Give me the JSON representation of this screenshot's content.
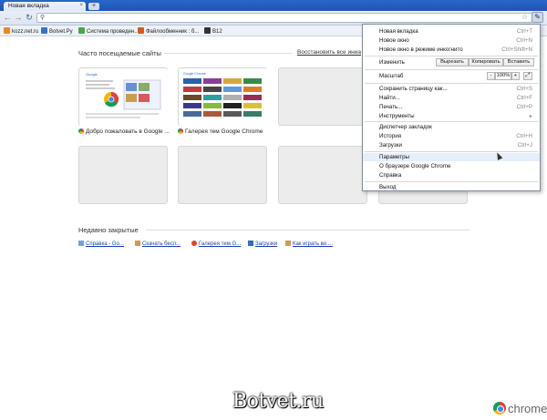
{
  "tab": {
    "title": "Новая вкладка",
    "close": "×"
  },
  "newtab": "+",
  "toolbar": {
    "back": "←",
    "forward": "→",
    "reload": "↻",
    "search_glyph": "⚲",
    "star": "☆",
    "wrench": "✎"
  },
  "bookmarks": [
    {
      "label": "kozz.net.ru",
      "color": "#e48a2a"
    },
    {
      "label": "Botvet.Ру",
      "color": "#3a70c8"
    },
    {
      "label": "Система проведен...",
      "color": "#4aa64a"
    },
    {
      "label": "Файлообменник : б...",
      "color": "#d65a1a"
    },
    {
      "label": "B12",
      "color": "#333333"
    }
  ],
  "most_visited": {
    "title": "Часто посещаемые сайты",
    "restore": "Восстановить все иниатюры",
    "items": [
      {
        "label": "Добро пожаловать в Google ...",
        "filled": true
      },
      {
        "label": "Галерея тем Google Chrome",
        "filled": true
      },
      {
        "label": "",
        "filled": false
      },
      {
        "label": "",
        "filled": false
      },
      {
        "label": "",
        "filled": false
      },
      {
        "label": "",
        "filled": false
      },
      {
        "label": "",
        "filled": false
      }
    ]
  },
  "recently_closed": {
    "title": "Недавно закрытые",
    "items": [
      {
        "label": "Справка - Go...",
        "color": "#7aa0d8"
      },
      {
        "label": "Скачать бесп...",
        "color": "#c9a04a"
      },
      {
        "label": "Галерея тем G...",
        "color": "#db4437"
      },
      {
        "label": "Загрузки",
        "color": "#3a6ab8"
      },
      {
        "label": "Как играть во ...",
        "color": "#c9a04a"
      }
    ]
  },
  "menu": {
    "new_tab": {
      "label": "Новая вкладка",
      "shortcut": "Ctrl+T"
    },
    "new_window": {
      "label": "Новое окно",
      "shortcut": "Ctrl+N"
    },
    "incognito": {
      "label": "Новое окно в режиме инкогнито",
      "shortcut": "Ctrl+Shift+N"
    },
    "edit": {
      "label": "Изменить",
      "cut": "Вырезать",
      "copy": "Копировать",
      "paste": "Вставить"
    },
    "zoom": {
      "label": "Масштаб",
      "minus": "-",
      "value": "100%",
      "plus": "+",
      "fullscreen": "⤢"
    },
    "save": {
      "label": "Сохранить страницу как...",
      "shortcut": "Ctrl+S"
    },
    "find": {
      "label": "Найти...",
      "shortcut": "Ctrl+F"
    },
    "print": {
      "label": "Печать...",
      "shortcut": "Ctrl+P"
    },
    "tools": {
      "label": "Инструменты",
      "arrow": "▸"
    },
    "bookmark_manager": {
      "label": "Диспетчер закладок"
    },
    "history": {
      "label": "История",
      "shortcut": "Ctrl+H"
    },
    "downloads": {
      "label": "Загрузки",
      "shortcut": "Ctrl+J"
    },
    "settings": {
      "label": "Параметры"
    },
    "about": {
      "label": "О браузере Google Chrome"
    },
    "help": {
      "label": "Справка"
    },
    "exit": {
      "label": "Выход"
    }
  },
  "footer": {
    "watermark": "Botvet.ru",
    "brand": "chrome"
  }
}
